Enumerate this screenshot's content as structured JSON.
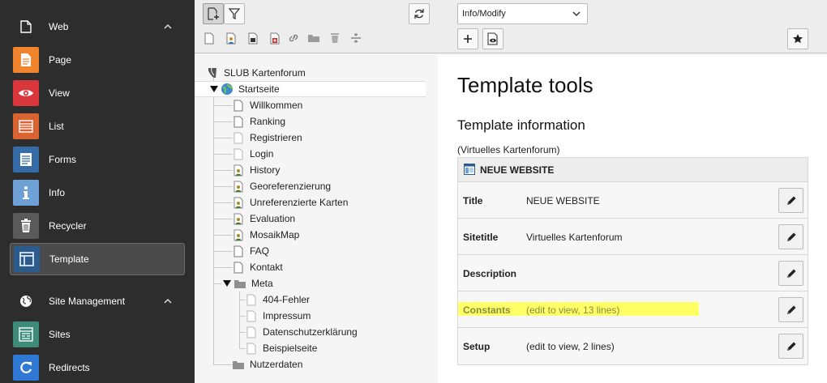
{
  "module_menu": {
    "groups": [
      {
        "label": "Web",
        "icon": "page-icon",
        "modules": [
          {
            "label": "Page",
            "icon": "page-module-icon",
            "color": "#f0852d"
          },
          {
            "label": "View",
            "icon": "eye-icon",
            "color": "#d9373c"
          },
          {
            "label": "List",
            "icon": "list-icon",
            "color": "#d96432"
          },
          {
            "label": "Forms",
            "icon": "forms-icon",
            "color": "#356ba6"
          },
          {
            "label": "Info",
            "icon": "info-icon",
            "color": "#6ea2d7"
          },
          {
            "label": "Recycler",
            "icon": "trash-icon",
            "color": "#5a5a5a"
          },
          {
            "label": "Template",
            "icon": "template-icon",
            "color": "#2c5c8e",
            "active": true
          }
        ]
      },
      {
        "label": "Site Management",
        "icon": "globe-icon",
        "modules": [
          {
            "label": "Sites",
            "icon": "sites-icon",
            "color": "#3d8c7a"
          },
          {
            "label": "Redirects",
            "icon": "redirect-icon",
            "color": "#2f78d3"
          }
        ]
      }
    ]
  },
  "page_tree": {
    "root": "SLUB Kartenforum",
    "nodes": [
      {
        "label": "Startseite",
        "level": 1,
        "type": "site-root",
        "expanded": true,
        "selected": true
      },
      {
        "label": "Willkommen",
        "level": 2,
        "type": "page"
      },
      {
        "label": "Ranking",
        "level": 2,
        "type": "page"
      },
      {
        "label": "Registrieren",
        "level": 2,
        "type": "page-light"
      },
      {
        "label": "Login",
        "level": 2,
        "type": "page-light"
      },
      {
        "label": "History",
        "level": 2,
        "type": "page-user"
      },
      {
        "label": "Georeferenzierung",
        "level": 2,
        "type": "page-user"
      },
      {
        "label": "Unreferenzierte Karten",
        "level": 2,
        "type": "page-user"
      },
      {
        "label": "Evaluation",
        "level": 2,
        "type": "page-user"
      },
      {
        "label": "MosaikMap",
        "level": 2,
        "type": "page-user"
      },
      {
        "label": "FAQ",
        "level": 2,
        "type": "page"
      },
      {
        "label": "Kontakt",
        "level": 2,
        "type": "page"
      },
      {
        "label": "Meta",
        "level": 2,
        "type": "folder",
        "expanded": true
      },
      {
        "label": "404-Fehler",
        "level": 3,
        "type": "page-light"
      },
      {
        "label": "Impressum",
        "level": 3,
        "type": "page-light"
      },
      {
        "label": "Datenschutzerklärung",
        "level": 3,
        "type": "page-light"
      },
      {
        "label": "Beispielseite",
        "level": 3,
        "type": "page-light"
      },
      {
        "label": "Nutzerdaten",
        "level": 2,
        "type": "folder"
      }
    ]
  },
  "doc_header": {
    "function_menu": "Info/Modify"
  },
  "content": {
    "title": "Template tools",
    "section_title": "Template information",
    "template_label": "(Virtuelles Kartenforum)",
    "table_header": "NEUE WEBSITE",
    "rows": [
      {
        "key": "Title",
        "value": "NEUE WEBSITE",
        "highlight": false
      },
      {
        "key": "Sitetitle",
        "value": "Virtuelles Kartenforum",
        "highlight": false
      },
      {
        "key": "Description",
        "value": "",
        "highlight": false
      },
      {
        "key": "Constants",
        "value": "(edit to view, 13 lines)",
        "highlight": true
      },
      {
        "key": "Setup",
        "value": "(edit to view, 2 lines)",
        "highlight": false
      }
    ]
  }
}
